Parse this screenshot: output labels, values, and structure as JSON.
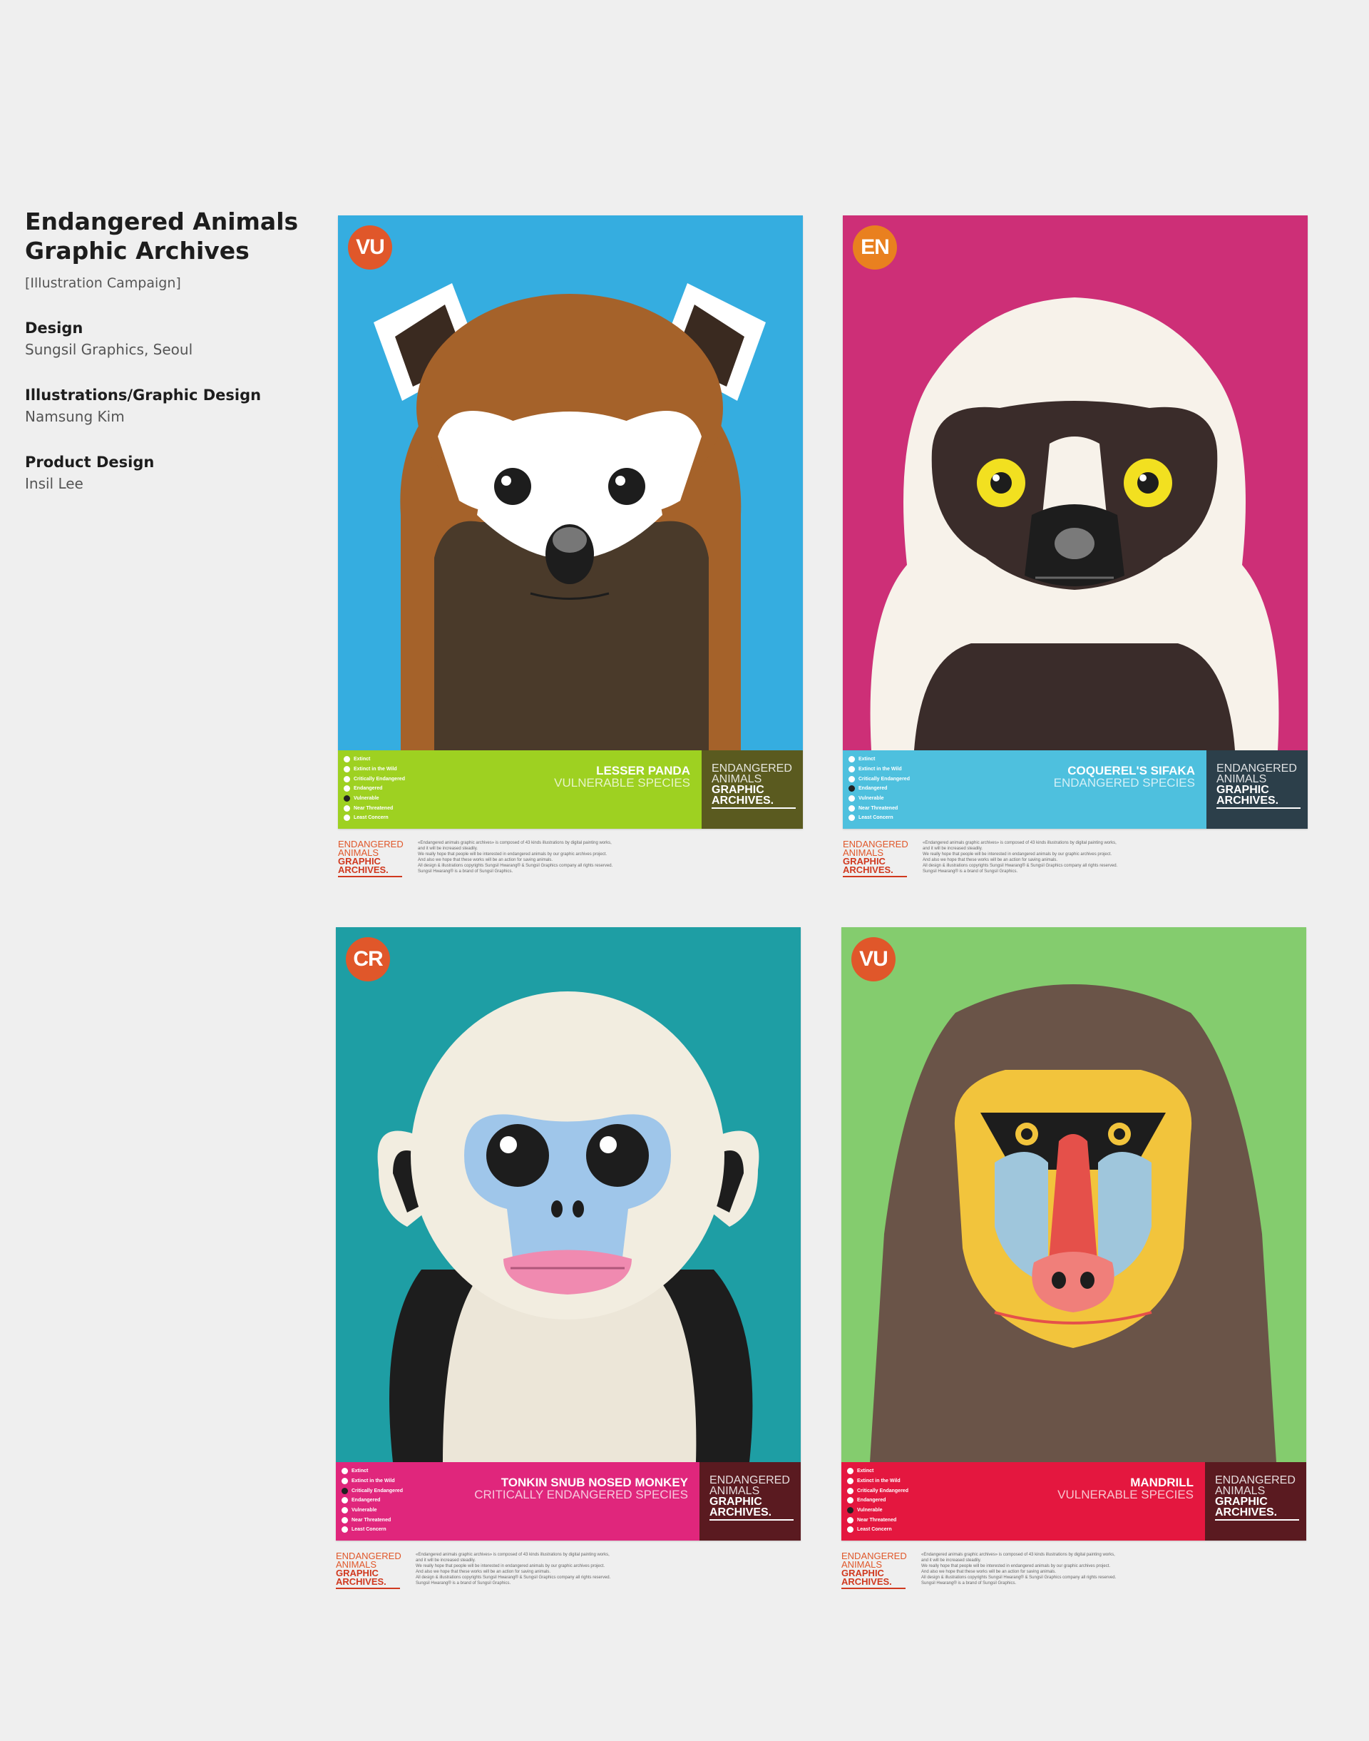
{
  "sidebar": {
    "title_line1": "Endangered Animals",
    "title_line2": "Graphic Archives",
    "subtitle": "[Illustration Campaign]",
    "credits": [
      {
        "label": "Design",
        "value": "Sungsil Graphics, Seoul"
      },
      {
        "label": "Illustrations/Graphic Design",
        "value": "Namsung Kim"
      },
      {
        "label": "Product Design",
        "value": "Insil Lee"
      }
    ]
  },
  "brand": {
    "line1": "ENDANGERED",
    "line2": "ANIMALS",
    "line3": "GRAPHIC",
    "line4": "ARCHIVES."
  },
  "status_levels": [
    "Extinct",
    "Extinct in the Wild",
    "Critically Endangered",
    "Endangered",
    "Vulnerable",
    "Near Threatened",
    "Least Concern"
  ],
  "fine_print": [
    "«Endangered animals graphic archives» is composed of 43 kinds illustrations by digital painting works,",
    "and it will be increased steadily.",
    "We really hope that people will be interested in endangered animals by our graphic archives project.",
    "And also we hope that these works will be an action for saving animals.",
    "All design & illustrations copyrights Sungsil Hwarang® & Sungsil Graphics company all rights reserved.",
    "Sungsil Hwarang® is a brand of Sungsil Graphics."
  ],
  "posters": [
    {
      "badge": "VU",
      "name": "LESSER PANDA",
      "status": "VULNERABLE SPECIES",
      "active_index": 4,
      "colors": {
        "bg": "#35ade0",
        "band": "#9ed121",
        "brand": "#5a5a1f",
        "badge": "#e0572a"
      }
    },
    {
      "badge": "EN",
      "name": "COQUEREL'S SIFAKA",
      "status": "ENDANGERED SPECIES",
      "active_index": 3,
      "colors": {
        "bg": "#cd2f77",
        "band": "#4ec0de",
        "brand": "#2c3f4a",
        "badge": "#e9801f"
      }
    },
    {
      "badge": "CR",
      "name": "TONKIN SNUB NOSED MONKEY",
      "status": "CRITICALLY ENDANGERED SPECIES",
      "active_index": 2,
      "colors": {
        "bg": "#1e9ea4",
        "band": "#e0267c",
        "brand": "#5a1a20",
        "badge": "#e0572a"
      }
    },
    {
      "badge": "VU",
      "name": "MANDRILL",
      "status": "VULNERABLE SPECIES",
      "active_index": 4,
      "colors": {
        "bg": "#84cc6e",
        "band": "#e4173f",
        "brand": "#5a1a20",
        "badge": "#e0572a"
      }
    }
  ]
}
